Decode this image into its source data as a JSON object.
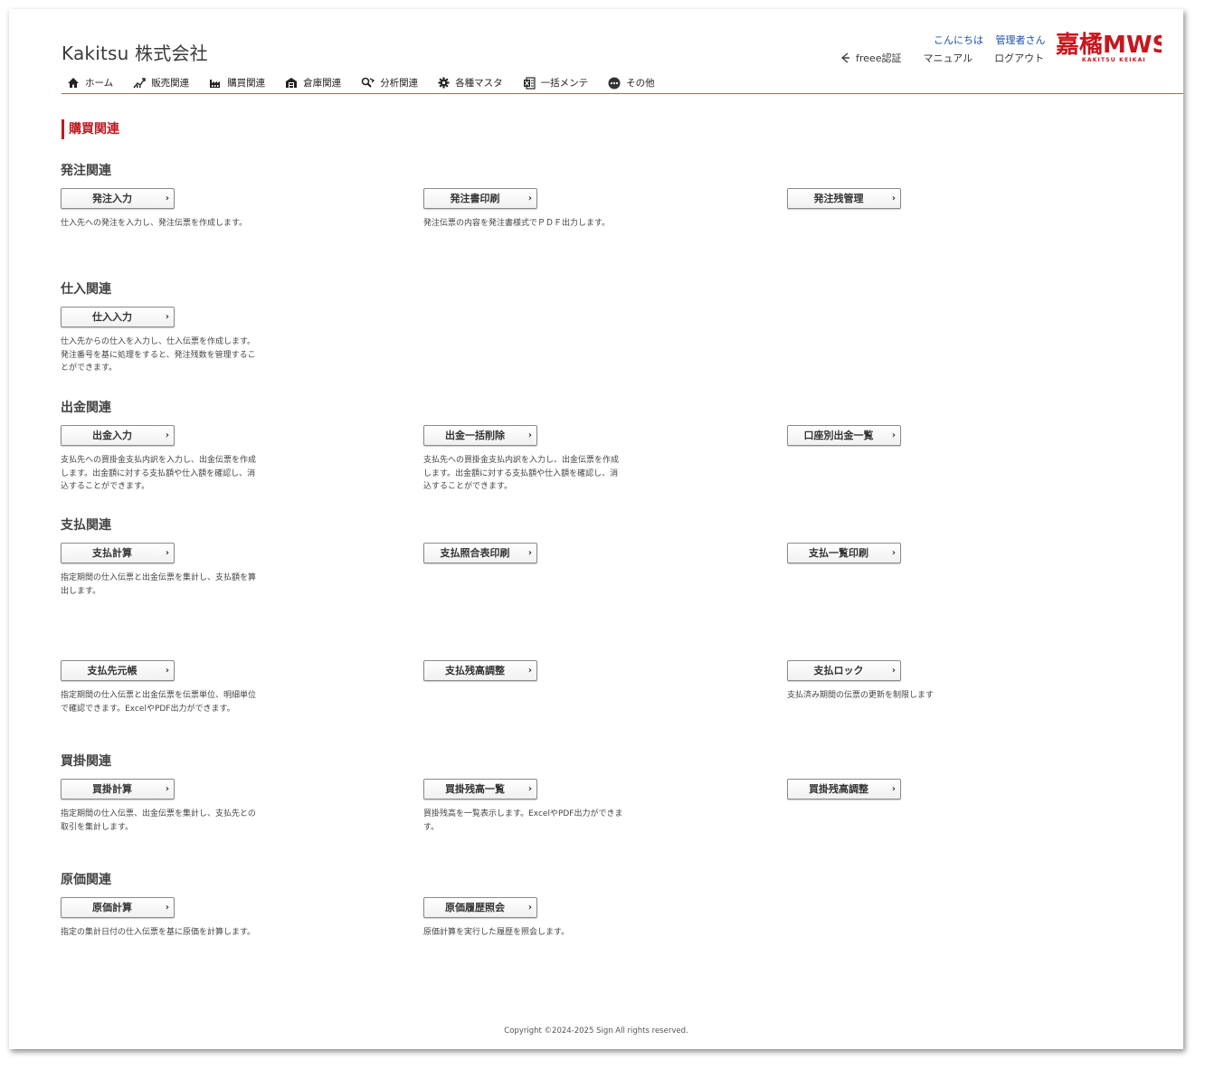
{
  "header": {
    "company": "Kakitsu 株式会社",
    "greeting": "こんにちは",
    "user": "管理者さん",
    "links": {
      "freee": "freee認証",
      "manual": "マニュアル",
      "logout": "ログアウト"
    },
    "logo_text": "嘉橘MWS",
    "logo_sub": "KAKITSU KEIKAI"
  },
  "nav": [
    {
      "label": "ホーム",
      "icon": "home-icon"
    },
    {
      "label": "販売関連",
      "icon": "chart-up-icon"
    },
    {
      "label": "購買関連",
      "icon": "factory-icon"
    },
    {
      "label": "倉庫関連",
      "icon": "warehouse-icon"
    },
    {
      "label": "分析関連",
      "icon": "analysis-icon"
    },
    {
      "label": "各種マスタ",
      "icon": "gear-icon"
    },
    {
      "label": "一括メンテ",
      "icon": "excel-icon"
    },
    {
      "label": "その他",
      "icon": "more-icon"
    }
  ],
  "page_title": "購買関連",
  "sections": [
    {
      "title": "発注関連",
      "items": [
        {
          "button": "発注入力",
          "desc": "仕入先への発注を入力し、発注伝票を作成します。"
        },
        {
          "button": "発注書印刷",
          "desc": "発注伝票の内容を発注書様式でＰＤＦ出力します。"
        },
        {
          "button": "発注残管理",
          "desc": ""
        }
      ]
    },
    {
      "title": "仕入関連",
      "items": [
        {
          "button": "仕入入力",
          "desc": "仕入先からの仕入を入力し、仕入伝票を作成します。発注番号を基に処理をすると、発注残数を管理することができます。"
        }
      ]
    },
    {
      "title": "出金関連",
      "items": [
        {
          "button": "出金入力",
          "desc": "支払先への買掛金支払内訳を入力し、出金伝票を作成します。出金額に対する支払額や仕入額を確認し、消込することができます。"
        },
        {
          "button": "出金一括削除",
          "desc": "支払先への買掛金支払内訳を入力し、出金伝票を作成します。出金額に対する支払額や仕入額を確認し、消込することができます。"
        },
        {
          "button": "口座別出金一覧",
          "desc": ""
        }
      ]
    },
    {
      "title": "支払関連",
      "items": [
        {
          "button": "支払計算",
          "desc": "指定期間の仕入伝票と出金伝票を集計し、支払額を算出します。"
        },
        {
          "button": "支払照合表印刷",
          "desc": ""
        },
        {
          "button": "支払一覧印刷",
          "desc": ""
        },
        {
          "button": "支払先元帳",
          "desc": "指定期間の仕入伝票と出金伝票を伝票単位、明細単位で確認できます。ExcelやPDF出力ができます。"
        },
        {
          "button": "支払残高調整",
          "desc": ""
        },
        {
          "button": "支払ロック",
          "desc": "支払済み期間の伝票の更新を制限します"
        }
      ]
    },
    {
      "title": "買掛関連",
      "items": [
        {
          "button": "買掛計算",
          "desc": "指定期間の仕入伝票、出金伝票を集計し、支払先との取引を集計します。"
        },
        {
          "button": "買掛残高一覧",
          "desc": "買掛残高を一覧表示します。ExcelやPDF出力ができます。"
        },
        {
          "button": "買掛残高調整",
          "desc": ""
        }
      ]
    },
    {
      "title": "原価関連",
      "items": [
        {
          "button": "原価計算",
          "desc": "指定の集計日付の仕入伝票を基に原価を計算します。"
        },
        {
          "button": "原価履歴照会",
          "desc": "原価計算を実行した履歴を照会します。"
        }
      ]
    }
  ],
  "footer": "Copyright ©2024-2025 Sign All rights reserved."
}
